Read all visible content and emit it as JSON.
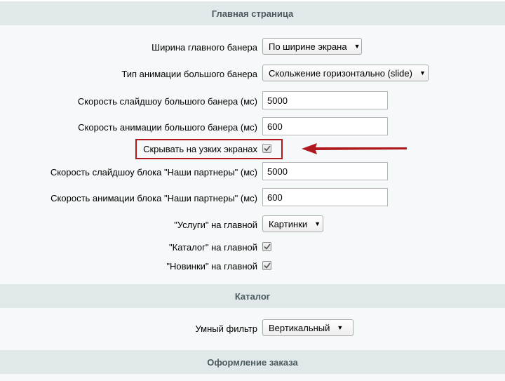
{
  "sections": {
    "main_page": {
      "title": "Главная страница"
    },
    "catalog": {
      "title": "Каталог"
    },
    "order": {
      "title": "Оформление заказа"
    }
  },
  "fields": {
    "banner_width": {
      "label": "Ширина главного банера",
      "value": "По ширине экрана"
    },
    "animation_type": {
      "label": "Тип анимации большого банера",
      "value": "Скольжение горизонтально (slide)"
    },
    "slideshow_speed": {
      "label": "Скорость слайдшоу большого банера (мс)",
      "value": "5000"
    },
    "animation_speed": {
      "label": "Скорость анимации большого банера (мс)",
      "value": "600"
    },
    "hide_narrow": {
      "label": "Скрывать на узких экранах",
      "checked": true
    },
    "partners_slideshow_speed": {
      "label": "Скорость слайдшоу блока \"Наши партнеры\" (мс)",
      "value": "5000"
    },
    "partners_animation_speed": {
      "label": "Скорость анимации блока \"Наши партнеры\" (мс)",
      "value": "600"
    },
    "services_main": {
      "label": "\"Услуги\" на главной",
      "value": "Картинки"
    },
    "catalog_main": {
      "label": "\"Каталог\" на главной",
      "checked": true
    },
    "news_main": {
      "label": "\"Новинки\" на главной",
      "checked": true
    },
    "smart_filter": {
      "label": "Умный фильтр",
      "value": "Вертикальный"
    }
  },
  "icons": {
    "checkmark": "checkmark-icon",
    "dropdown": "triangle-down-icon",
    "annotation_arrow": "arrow-left-icon"
  },
  "colors": {
    "section_header_bg": "#e0e8ea",
    "section_body_bg": "#f5f9f9",
    "annotation_red": "#b0191e"
  }
}
